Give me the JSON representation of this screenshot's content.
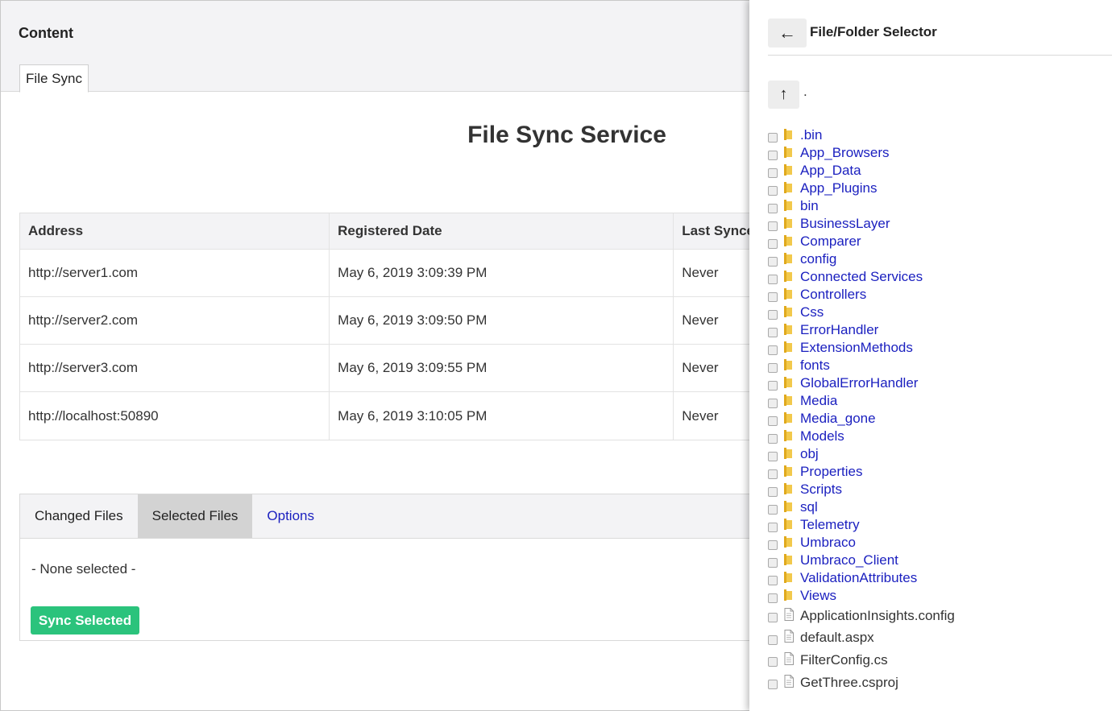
{
  "header": {
    "title": "Content",
    "tab_label": "File Sync"
  },
  "page_title": "File Sync Service",
  "table": {
    "columns": [
      "Address",
      "Registered Date",
      "Last Synced"
    ],
    "rows": [
      [
        "http://server1.com",
        "May 6, 2019 3:09:39 PM",
        "Never"
      ],
      [
        "http://server2.com",
        "May 6, 2019 3:09:50 PM",
        "Never"
      ],
      [
        "http://server3.com",
        "May 6, 2019 3:09:55 PM",
        "Never"
      ],
      [
        "http://localhost:50890",
        "May 6, 2019 3:10:05 PM",
        "Never"
      ]
    ]
  },
  "panel": {
    "tabs": [
      "Changed Files",
      "Selected Files",
      "Options"
    ],
    "active_tab": "Selected Files",
    "none_selected": "- None selected -",
    "sync_button": "Sync Selected"
  },
  "selector": {
    "back_icon": "←",
    "title": "File/Folder Selector",
    "up_icon": "↑",
    "current_dir": ".",
    "folders": [
      ".bin",
      "App_Browsers",
      "App_Data",
      "App_Plugins",
      "bin",
      "BusinessLayer",
      "Comparer",
      "config",
      "Connected Services",
      "Controllers",
      "Css",
      "ErrorHandler",
      "ExtensionMethods",
      "fonts",
      "GlobalErrorHandler",
      "Media",
      "Media_gone",
      "Models",
      "obj",
      "Properties",
      "Scripts",
      "sql",
      "Telemetry",
      "Umbraco",
      "Umbraco_Client",
      "ValidationAttributes",
      "Views"
    ],
    "files": [
      "ApplicationInsights.config",
      "default.aspx",
      "FilterConfig.cs",
      "GetThree.csproj"
    ]
  },
  "colors": {
    "accent_green": "#2bc37c",
    "link_blue": "#1a1fbf",
    "folder_yellow": "#f2c94c"
  }
}
